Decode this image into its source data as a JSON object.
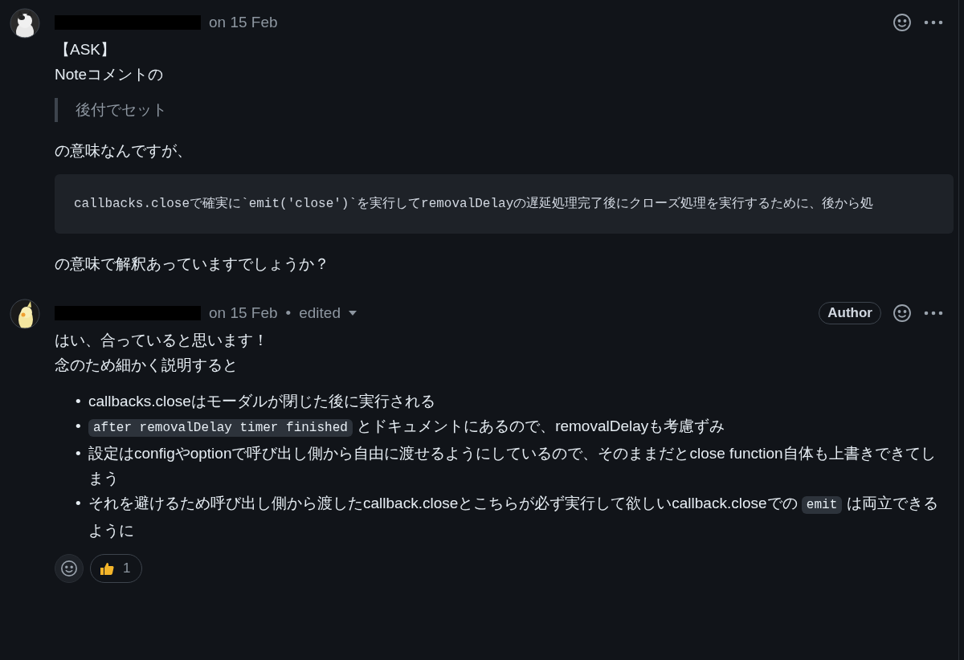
{
  "comments": [
    {
      "date": "on 15 Feb",
      "body": [
        {
          "kind": "paragraph",
          "lines": [
            "【ASK】",
            "Noteコメントの"
          ]
        },
        {
          "kind": "quote",
          "text": "後付でセット"
        },
        {
          "kind": "paragraph",
          "lines": [
            "の意味なんですが、"
          ]
        },
        {
          "kind": "code",
          "text": "callbacks.closeで確実に`emit('close')`を実行してremovalDelayの遅延処理完了後にクローズ処理を実行するために、後から処"
        },
        {
          "kind": "paragraph",
          "lines": [
            "の意味で解釈あっていますでしょうか？"
          ]
        }
      ]
    },
    {
      "date": "on 15 Feb",
      "badge": "Author",
      "edited": {
        "separator": "•",
        "label": "edited"
      },
      "body": [
        {
          "kind": "paragraph",
          "lines": [
            "はい、合っていると思います！",
            "念のため細かく説明すると"
          ]
        },
        {
          "kind": "list",
          "items": [
            {
              "bullet": "•",
              "parts": [
                {
                  "kind": "text",
                  "text": "callbacks.closeはモーダルが閉じた後に実行される"
                }
              ]
            },
            {
              "bullet": "•",
              "parts": [
                {
                  "kind": "code",
                  "text": "after removalDelay timer finished"
                },
                {
                  "kind": "text",
                  "text": " とドキュメントにあるので、removalDelayも考慮ずみ"
                }
              ]
            },
            {
              "bullet": "•",
              "parts": [
                {
                  "kind": "text",
                  "text": "設定はconfigやoptionで呼び出し側から自由に渡せるようにしているので、そのままだとclose function自体も上書きできてしまう"
                }
              ]
            },
            {
              "bullet": "•",
              "parts": [
                {
                  "kind": "text",
                  "text": "それを避けるため呼び出し側から渡したcallback.closeとこちらが必ず実行して欲しいcallback.closeでの "
                },
                {
                  "kind": "code",
                  "text": "emit"
                },
                {
                  "kind": "text",
                  "text": " は両立できるように"
                }
              ]
            }
          ]
        }
      ],
      "reactions": [
        {
          "kind": "thumbs_up",
          "count": "1"
        }
      ]
    }
  ]
}
